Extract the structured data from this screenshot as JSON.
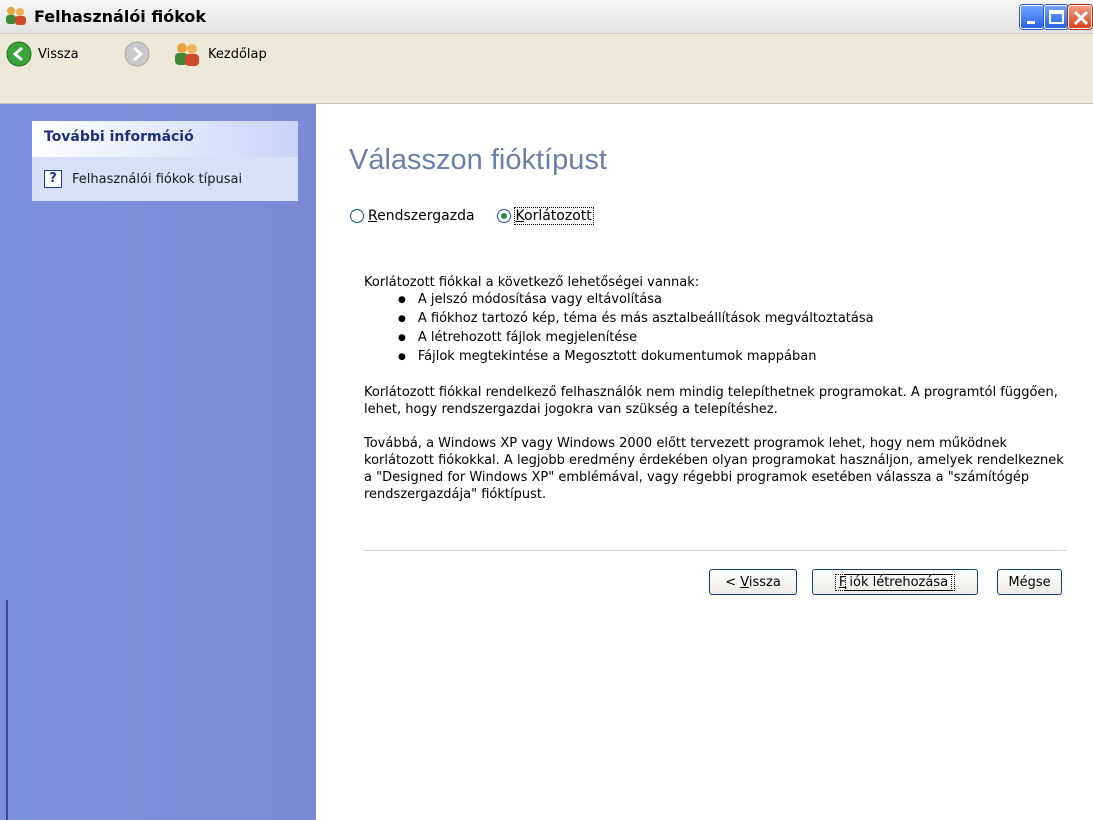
{
  "window": {
    "title": "Felhasználói fiókok"
  },
  "toolbar": {
    "back_label": "Vissza",
    "home_label": "Kezdőlap"
  },
  "sidebar": {
    "section_title": "További információ",
    "link_label": "Felhasználói fiókok típusai"
  },
  "main": {
    "heading": "Válasszon fióktípust",
    "radio_admin_rest": "endszergazda",
    "radio_admin_accel": "R",
    "radio_limited_rest": "orlátozott",
    "radio_limited_accel": "K",
    "selected": "Korlátozott",
    "intro": "Korlátozott fiókkal a következő lehetőségei vannak:",
    "bullets": [
      "A jelszó módosítása vagy eltávolítása",
      "A fiókhoz tartozó kép, téma és más asztalbeállítások megváltoztatása",
      "A létrehozott fájlok megjelenítése",
      "Fájlok megtekintése a Megosztott dokumentumok mappában"
    ],
    "paragraph1": "Korlátozott fiókkal rendelkező felhasználók nem mindig telepíthetnek programokat. A programtól függően, lehet, hogy rendszergazdai jogokra van szükség a telepítéshez.",
    "paragraph2": "Továbbá, a Windows XP vagy Windows 2000 előtt tervezett programok lehet, hogy nem működnek korlátozott fiókokkal. A legjobb eredmény érdekében olyan programokat használjon, amelyek rendelkeznek a \"Designed for Windows XP\" emblémával, vagy régebbi programok esetében válassza a \"számítógép rendszergazdája\" fióktípust."
  },
  "buttons": {
    "back_prefix": "< ",
    "back_accel": "V",
    "back_rest": "issza",
    "create_accel": "F",
    "create_rest": "iók létrehozása",
    "cancel": "Mégse"
  },
  "colors": {
    "sidebar_bg": "#7c8fde",
    "heading": "#6b7fa8",
    "toolbar_bg": "#ede9d8"
  }
}
